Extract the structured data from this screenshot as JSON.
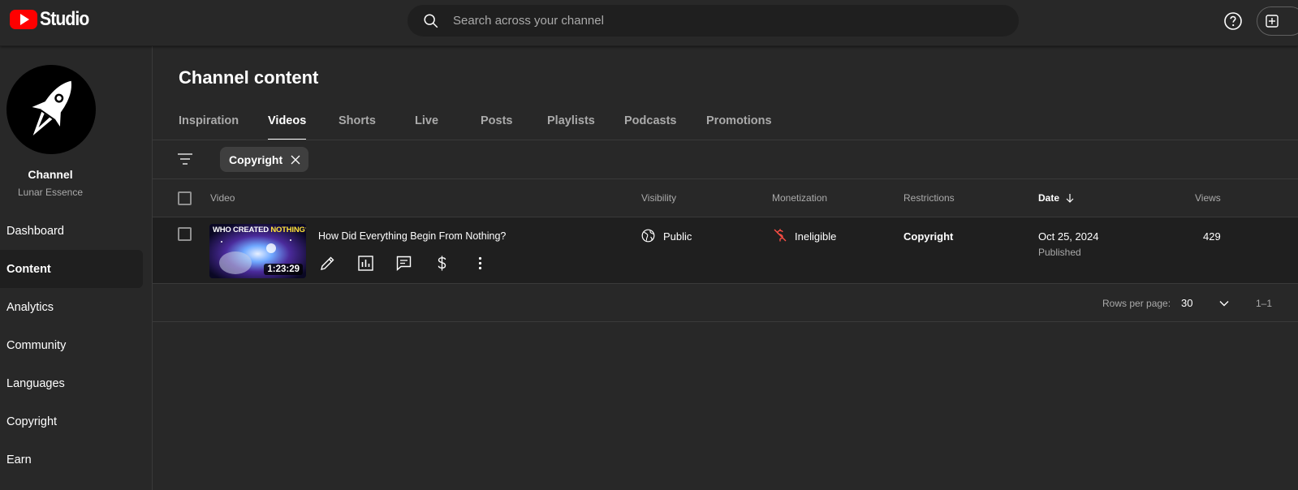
{
  "app": {
    "logo_text": "Studio",
    "search_placeholder": "Search across your channel"
  },
  "sidebar": {
    "channel_title": "Channel",
    "channel_name": "Lunar Essence",
    "items": [
      {
        "label": "Dashboard"
      },
      {
        "label": "Content",
        "active": true
      },
      {
        "label": "Analytics"
      },
      {
        "label": "Community"
      },
      {
        "label": "Languages"
      },
      {
        "label": "Copyright"
      },
      {
        "label": "Earn"
      }
    ]
  },
  "main": {
    "title": "Channel content",
    "tabs": [
      {
        "label": "Inspiration"
      },
      {
        "label": "Videos",
        "active": true
      },
      {
        "label": "Shorts"
      },
      {
        "label": "Live"
      },
      {
        "label": "Posts"
      },
      {
        "label": "Playlists"
      },
      {
        "label": "Podcasts"
      },
      {
        "label": "Promotions"
      }
    ],
    "filter_chip": "Copyright",
    "columns": {
      "video": "Video",
      "visibility": "Visibility",
      "monetization": "Monetization",
      "restrictions": "Restrictions",
      "date": "Date",
      "views": "Views"
    },
    "rows": [
      {
        "thumbnail_caption_white": "WHO CREATED ",
        "thumbnail_caption_yellow": "NOTHING?",
        "duration": "1:23:29",
        "title": "How Did Everything Begin From Nothing?",
        "visibility": "Public",
        "monetization": "Ineligible",
        "restrictions": "Copyright",
        "date": "Oct 25, 2024",
        "date_status": "Published",
        "views": "429"
      }
    ],
    "pager": {
      "rows_per_page_label": "Rows per page:",
      "rows_per_page": "30",
      "range": "1–1"
    }
  },
  "colors": {
    "background": "#282828",
    "row_background": "#1f1f1f",
    "brand_red": "#ff0000",
    "ineligible_icon": "#ff4e45"
  }
}
